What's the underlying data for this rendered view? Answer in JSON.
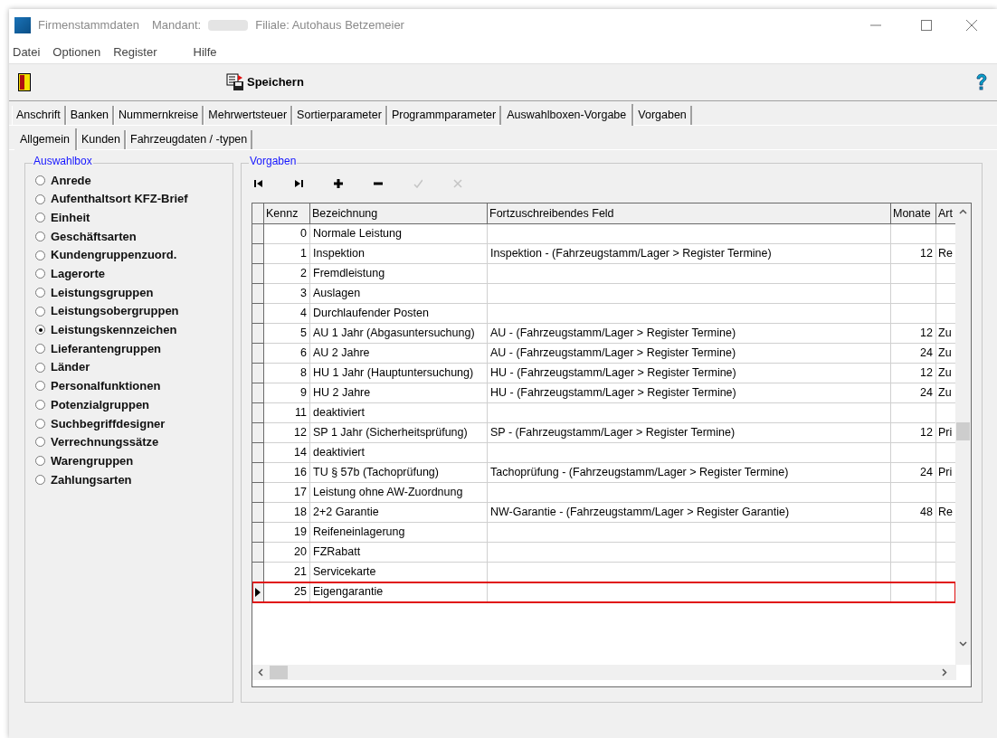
{
  "window": {
    "title": "Firmenstammdaten",
    "mandant_label": "Mandant:",
    "filiale": "Filiale: Autohaus Betzemeier"
  },
  "menu": [
    "Datei",
    "Optionen",
    "Register",
    "Hilfe"
  ],
  "toolbar": {
    "save_label": "Speichern"
  },
  "tabs": [
    {
      "label": "Anschrift",
      "selected": false
    },
    {
      "label": "Banken",
      "selected": false
    },
    {
      "label": "Nummernkreise",
      "selected": false
    },
    {
      "label": "Mehrwertsteuer",
      "selected": false
    },
    {
      "label": "Sortierparameter",
      "selected": false
    },
    {
      "label": "Programmparameter",
      "selected": false
    },
    {
      "label": "Auswahlboxen-Vorgabe",
      "selected": true
    },
    {
      "label": "Vorgaben",
      "selected": false
    }
  ],
  "subtabs": [
    {
      "label": "Allgemein",
      "selected": true
    },
    {
      "label": "Kunden",
      "selected": false
    },
    {
      "label": "Fahrzeugdaten / -typen",
      "selected": false
    }
  ],
  "auswahlbox": {
    "title": "Auswahlbox",
    "options": [
      {
        "label": "Anrede",
        "selected": false
      },
      {
        "label": "Aufenthaltsort KFZ-Brief",
        "selected": false
      },
      {
        "label": "Einheit",
        "selected": false
      },
      {
        "label": "Geschäftsarten",
        "selected": false
      },
      {
        "label": "Kundengruppenzuord.",
        "selected": false
      },
      {
        "label": "Lagerorte",
        "selected": false
      },
      {
        "label": "Leistungsgruppen",
        "selected": false
      },
      {
        "label": "Leistungsobergruppen",
        "selected": false
      },
      {
        "label": "Leistungskennzeichen",
        "selected": true
      },
      {
        "label": "Lieferantengruppen",
        "selected": false
      },
      {
        "label": "Länder",
        "selected": false
      },
      {
        "label": "Personalfunktionen",
        "selected": false
      },
      {
        "label": "Potenzialgruppen",
        "selected": false
      },
      {
        "label": "Suchbegriffdesigner",
        "selected": false
      },
      {
        "label": "Verrechnungssätze",
        "selected": false
      },
      {
        "label": "Warengruppen",
        "selected": false
      },
      {
        "label": "Zahlungsarten",
        "selected": false
      }
    ]
  },
  "vorgaben": {
    "title": "Vorgaben",
    "navigator": [
      {
        "kind": "first",
        "disabled": false
      },
      {
        "kind": "last",
        "disabled": false
      },
      {
        "kind": "add",
        "disabled": false
      },
      {
        "kind": "delete",
        "disabled": false
      },
      {
        "kind": "post",
        "disabled": true
      },
      {
        "kind": "cancel",
        "disabled": true
      }
    ],
    "columns": [
      "Kennz",
      "Bezeichnung",
      "Fortzuschreibendes Feld",
      "Monate",
      "Art"
    ],
    "rows": [
      {
        "cells": [
          "0",
          "Normale Leistung",
          "",
          "",
          ""
        ],
        "selected": false
      },
      {
        "cells": [
          "1",
          "Inspektion",
          "Inspektion - (Fahrzeugstamm/Lager > Register Termine)",
          "12",
          "Re"
        ],
        "selected": false
      },
      {
        "cells": [
          "2",
          "Fremdleistung",
          "",
          "",
          ""
        ],
        "selected": false
      },
      {
        "cells": [
          "3",
          "Auslagen",
          "",
          "",
          ""
        ],
        "selected": false
      },
      {
        "cells": [
          "4",
          "Durchlaufender Posten",
          "",
          "",
          ""
        ],
        "selected": false
      },
      {
        "cells": [
          "5",
          "AU 1 Jahr (Abgasuntersuchung)",
          "AU - (Fahrzeugstamm/Lager > Register Termine)",
          "12",
          "Zu"
        ],
        "selected": false
      },
      {
        "cells": [
          "6",
          "AU 2 Jahre",
          "AU - (Fahrzeugstamm/Lager > Register Termine)",
          "24",
          "Zu"
        ],
        "selected": false
      },
      {
        "cells": [
          "8",
          "HU 1 Jahr (Hauptuntersuchung)",
          "HU - (Fahrzeugstamm/Lager > Register Termine)",
          "12",
          "Zu"
        ],
        "selected": false
      },
      {
        "cells": [
          "9",
          "HU 2 Jahre",
          "HU - (Fahrzeugstamm/Lager > Register Termine)",
          "24",
          "Zu"
        ],
        "selected": false
      },
      {
        "cells": [
          "11",
          "deaktiviert",
          "",
          "",
          ""
        ],
        "selected": false
      },
      {
        "cells": [
          "12",
          "SP 1 Jahr (Sicherheitsprüfung)",
          "SP - (Fahrzeugstamm/Lager > Register Termine)",
          "12",
          "Pri"
        ],
        "selected": false
      },
      {
        "cells": [
          "14",
          "deaktiviert",
          "",
          "",
          ""
        ],
        "selected": false
      },
      {
        "cells": [
          "16",
          "TU § 57b (Tachoprüfung)",
          "Tachoprüfung - (Fahrzeugstamm/Lager > Register Termine)",
          "24",
          "Pri"
        ],
        "selected": false
      },
      {
        "cells": [
          "17",
          "Leistung ohne AW-Zuordnung",
          "",
          "",
          ""
        ],
        "selected": false
      },
      {
        "cells": [
          "18",
          "2+2 Garantie",
          "NW-Garantie - (Fahrzeugstamm/Lager > Register Garantie)",
          "48",
          "Re"
        ],
        "selected": false
      },
      {
        "cells": [
          "19",
          "Reifeneinlagerung",
          "",
          "",
          ""
        ],
        "selected": false
      },
      {
        "cells": [
          "20",
          "FZRabatt",
          "",
          "",
          ""
        ],
        "selected": false
      },
      {
        "cells": [
          "21",
          "Servicekarte",
          "",
          "",
          ""
        ],
        "selected": false
      },
      {
        "cells": [
          "25",
          "Eigengarantie",
          "",
          "",
          ""
        ],
        "selected": true
      }
    ]
  }
}
